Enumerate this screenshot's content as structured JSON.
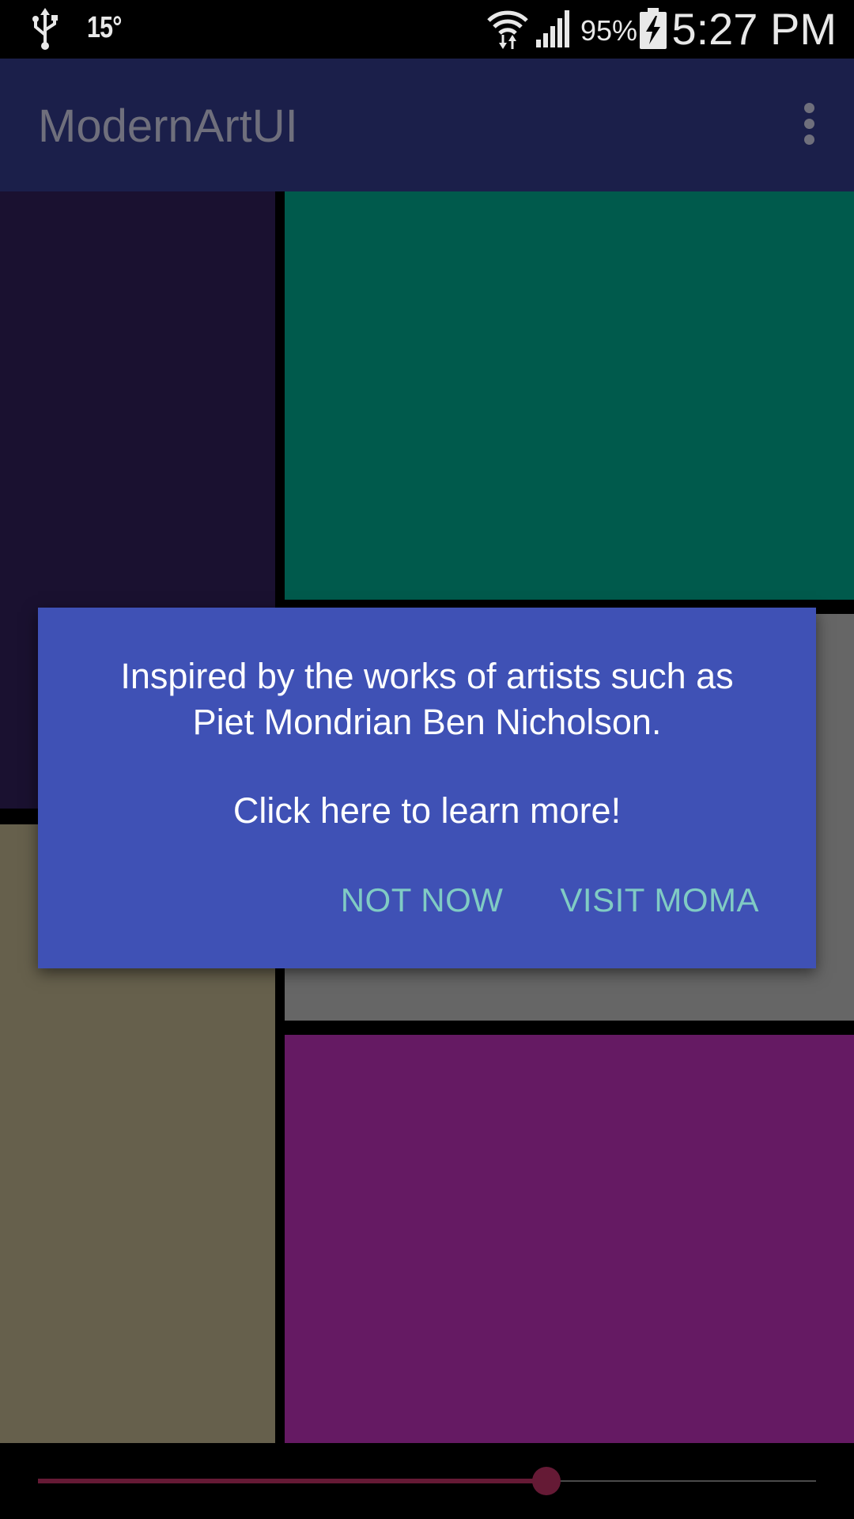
{
  "status_bar": {
    "temperature": "15°",
    "battery_percent": "95%",
    "time": "5:27 PM",
    "icons": [
      "usb-icon",
      "wifi-icon",
      "signal-icon",
      "battery-charging-icon"
    ]
  },
  "app_bar": {
    "title": "ModernArtUI",
    "overflow_icon": "more-vert-icon"
  },
  "panels": [
    {
      "name": "panel-top-left",
      "color": "#1a1130"
    },
    {
      "name": "panel-top-right",
      "color": "#005a4c"
    },
    {
      "name": "panel-middle-right",
      "color": "#666666"
    },
    {
      "name": "panel-bottom-left",
      "color": "#66604c"
    },
    {
      "name": "panel-bottom-right",
      "color": "#651a63"
    }
  ],
  "slider": {
    "value_fraction": 0.653,
    "active_color": "#651a35"
  },
  "dialog": {
    "line1": "Inspired by the works of artists such as",
    "line2": "Piet Mondrian Ben Nicholson.",
    "line3": "Click here to learn more!",
    "not_now_label": "NOT NOW",
    "visit_label": "VISIT MOMA",
    "background_color": "#3f51b5",
    "button_color": "#80cbc4"
  }
}
